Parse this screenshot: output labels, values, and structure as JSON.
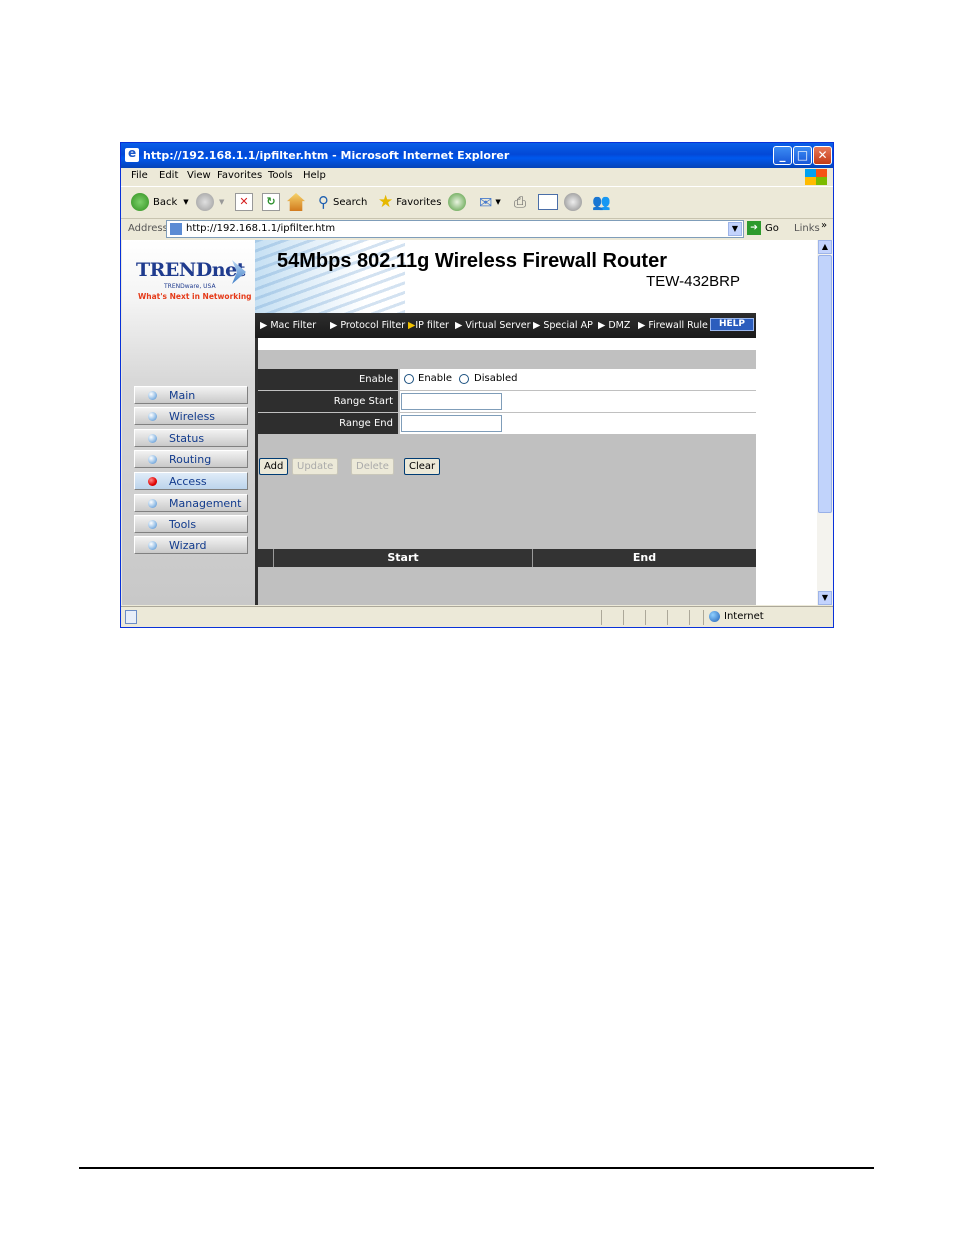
{
  "window": {
    "title": "http://192.168.1.1/ipfilter.htm - Microsoft Internet Explorer"
  },
  "menu": [
    "File",
    "Edit",
    "View",
    "Favorites",
    "Tools",
    "Help"
  ],
  "toolbar": {
    "back": "Back",
    "search": "Search",
    "favorites": "Favorites"
  },
  "address": {
    "label": "Address",
    "url": "http://192.168.1.1/ipfilter.htm",
    "go": "Go",
    "links": "Links"
  },
  "logo": {
    "brand": "TRENDnet",
    "sub": "TRENDware, USA",
    "tagline": "What's Next in Networking"
  },
  "banner": {
    "title": "54Mbps 802.11g Wireless Firewall Router",
    "model": "TEW-432BRP"
  },
  "tabs": [
    "Mac Filter",
    "Protocol Filter",
    "IP filter",
    "Virtual Server",
    "Special AP",
    "DMZ",
    "Firewall Rule"
  ],
  "help": "HELP",
  "nav": [
    {
      "label": "Main"
    },
    {
      "label": "Wireless"
    },
    {
      "label": "Status"
    },
    {
      "label": "Routing"
    },
    {
      "label": "Access"
    },
    {
      "label": "Management"
    },
    {
      "label": "Tools"
    },
    {
      "label": "Wizard"
    }
  ],
  "form": {
    "enable_label": "Enable",
    "opt_enable": "Enable",
    "opt_disabled": "Disabled",
    "range_start_label": "Range Start",
    "range_start_value": "",
    "range_end_label": "Range End",
    "range_end_value": ""
  },
  "buttons": {
    "add": "Add",
    "update": "Update",
    "delete": "Delete",
    "clear": "Clear"
  },
  "list": {
    "col_start": "Start",
    "col_end": "End"
  },
  "status": {
    "zone": "Internet"
  }
}
